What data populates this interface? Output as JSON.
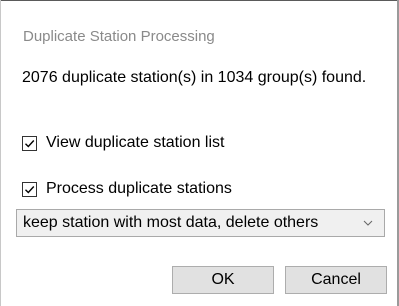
{
  "dialog": {
    "title": "Duplicate Station Processing",
    "message": "2076 duplicate station(s) in 1034 group(s) found."
  },
  "options": {
    "view_list": {
      "label": "View duplicate station list",
      "checked": true
    },
    "process": {
      "label": "Process duplicate stations",
      "checked": true
    }
  },
  "dropdown": {
    "selected": "keep station with most data, delete others",
    "icon": "chevron-down-icon"
  },
  "buttons": {
    "ok": "OK",
    "cancel": "Cancel"
  }
}
